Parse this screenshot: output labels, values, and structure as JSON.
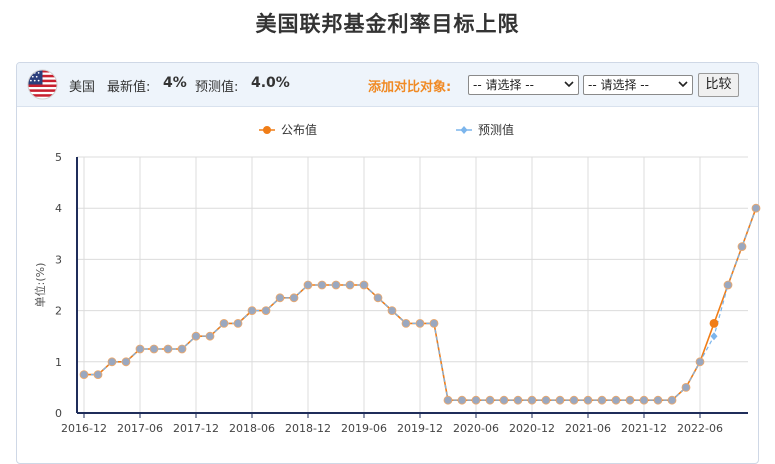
{
  "page": {
    "title": "美国联邦基金利率目标上限"
  },
  "toolbar": {
    "country": "美国",
    "latest_label": "最新值:",
    "latest_value": "4%",
    "forecast_label": "预测值:",
    "forecast_value": "4.0%",
    "compare_label": "添加对比对象:",
    "select1": "-- 请选择 --",
    "select2": "-- 请选择 --",
    "compare_button": "比较"
  },
  "icons": {
    "flag": "us-flag-icon",
    "dropdown": "chevron-down-icon"
  },
  "colors": {
    "published": "#f07d17",
    "forecast": "#7cb5ec",
    "axis": "#1f2d5a",
    "compare_label": "#f08a24"
  },
  "chart_data": {
    "type": "line",
    "title": "",
    "ylabel": "单位:(%)",
    "xlabel": "",
    "ylim": [
      0,
      5
    ],
    "yticks": [
      "0",
      "1",
      "2",
      "3",
      "4",
      "5"
    ],
    "grid": true,
    "legend_position": "top-center",
    "xticks": [
      {
        "index": 0,
        "label": "2016-12"
      },
      {
        "index": 4,
        "label": "2017-06"
      },
      {
        "index": 8,
        "label": "2017-12"
      },
      {
        "index": 12,
        "label": "2018-06"
      },
      {
        "index": 16,
        "label": "2018-12"
      },
      {
        "index": 20,
        "label": "2019-06"
      },
      {
        "index": 24,
        "label": "2019-12"
      },
      {
        "index": 28,
        "label": "2020-06"
      },
      {
        "index": 32,
        "label": "2020-12"
      },
      {
        "index": 36,
        "label": "2021-06"
      },
      {
        "index": 40,
        "label": "2021-12"
      },
      {
        "index": 44,
        "label": "2022-06"
      }
    ],
    "series": [
      {
        "name": "公布值",
        "color": "#f07d17",
        "values": [
          0.75,
          0.75,
          1,
          1,
          1.25,
          1.25,
          1.25,
          1.25,
          1.5,
          1.5,
          1.75,
          1.75,
          2,
          2,
          2.25,
          2.25,
          2.5,
          2.5,
          2.5,
          2.5,
          2.5,
          2.25,
          2,
          1.75,
          1.75,
          1.75,
          0.25,
          0.25,
          0.25,
          0.25,
          0.25,
          0.25,
          0.25,
          0.25,
          0.25,
          0.25,
          0.25,
          0.25,
          0.25,
          0.25,
          0.25,
          0.25,
          0.25,
          0.5,
          1,
          1.75,
          2.5,
          3.25,
          4
        ]
      },
      {
        "name": "预测值",
        "color": "#7cb5ec",
        "values": [
          0.75,
          0.75,
          1,
          1,
          1.25,
          1.25,
          1.25,
          1.25,
          1.5,
          1.5,
          1.75,
          1.75,
          2,
          2,
          2.25,
          2.25,
          2.5,
          2.5,
          2.5,
          2.5,
          2.5,
          2.25,
          2,
          1.75,
          1.75,
          1.75,
          0.25,
          0.25,
          0.25,
          0.25,
          0.25,
          0.25,
          0.25,
          0.25,
          0.25,
          0.25,
          0.25,
          0.25,
          0.25,
          0.25,
          0.25,
          0.25,
          0.25,
          0.5,
          1,
          1.5,
          2.5,
          3.25,
          4
        ]
      }
    ]
  }
}
